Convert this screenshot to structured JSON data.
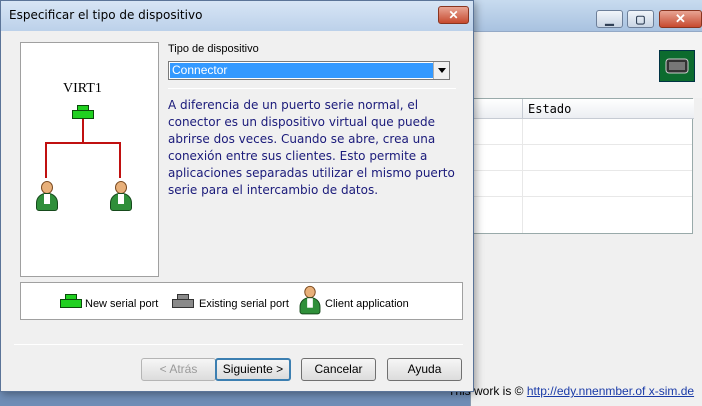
{
  "dialog": {
    "title": "Especificar el tipo de dispositivo",
    "close_glyph": "✕",
    "preview": {
      "device_label": "VIRT1"
    },
    "device_type": {
      "label": "Tipo de dispositivo",
      "selected": "Connector"
    },
    "description": "A diferencia de un puerto serie normal, el conector es un dispositivo virtual que puede abrirse dos veces. Cuando se abre, crea una conexión entre sus clientes. Esto permite a aplicaciones separadas utilizar el mismo puerto serie para el intercambio de datos.",
    "legend": {
      "new_port": "New serial port",
      "existing_port": "Existing serial port",
      "client_app": "Client application"
    },
    "buttons": {
      "back": "< Atrás",
      "next": "Siguiente >",
      "cancel": "Cancelar",
      "help": "Ayuda"
    }
  },
  "background_window": {
    "column_header": "Estado",
    "minimize_glyph": "▁",
    "maximize_glyph": "▢",
    "close_glyph": "✕"
  },
  "watermark": {
    "prefix": "This work is © ",
    "link": "http://edy.nnenmber.of x-sim.de"
  },
  "colors": {
    "port_new": "#20d020",
    "port_existing": "#8a8a8a",
    "wire": "#c01010",
    "selection": "#3399ff",
    "description_text": "#1a1a7a"
  }
}
